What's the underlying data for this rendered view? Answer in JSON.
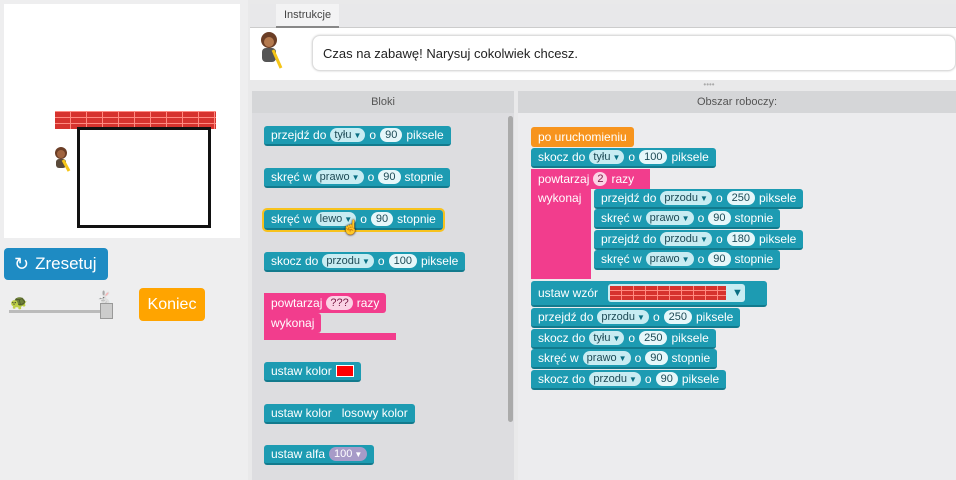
{
  "left": {
    "reset_label": "Zresetuj",
    "finish_label": "Koniec",
    "speed_slow_icon": "turtle-icon",
    "speed_fast_icon": "hare-icon"
  },
  "instructions": {
    "tab_label": "Instrukcje",
    "text": "Czas na zabawę! Narysuj cokolwiek chcesz."
  },
  "headers": {
    "blocks": "Bloki",
    "workspace": "Obszar roboczy:"
  },
  "toolbox": {
    "b1": {
      "text": "przejdź do",
      "dir": "tyłu",
      "o": "o",
      "num": "90",
      "unit": "piksele"
    },
    "b2": {
      "text": "skręć w",
      "dir": "prawo",
      "o": "o",
      "num": "90",
      "unit": "stopnie"
    },
    "b3": {
      "text": "skręć w",
      "dir": "lewo",
      "o": "o",
      "num": "90",
      "unit": "stopnie"
    },
    "b4": {
      "text": "skocz do",
      "dir": "przodu",
      "o": "o",
      "num": "100",
      "unit": "piksele"
    },
    "b5": {
      "text": "powtarzaj",
      "num": "???",
      "unit": "razy",
      "do": "wykonaj"
    },
    "b6": {
      "text": "ustaw kolor",
      "color": "#ff0000"
    },
    "b7": {
      "text": "ustaw kolor",
      "value": "losowy kolor"
    },
    "b8": {
      "text": "ustaw alfa",
      "num": "100"
    }
  },
  "workspace": {
    "w0": {
      "text": "po uruchomieniu"
    },
    "w1": {
      "text": "skocz do",
      "dir": "tyłu",
      "o": "o",
      "num": "100",
      "unit": "piksele"
    },
    "w2": {
      "text": "powtarzaj",
      "num": "2",
      "unit": "razy",
      "do": "wykonaj"
    },
    "w3": {
      "text": "przejdź do",
      "dir": "przodu",
      "o": "o",
      "num": "250",
      "unit": "piksele"
    },
    "w4": {
      "text": "skręć w",
      "dir": "prawo",
      "o": "o",
      "num": "90",
      "unit": "stopnie"
    },
    "w5": {
      "text": "przejdź do",
      "dir": "przodu",
      "o": "o",
      "num": "180",
      "unit": "piksele"
    },
    "w6": {
      "text": "skręć w",
      "dir": "prawo",
      "o": "o",
      "num": "90",
      "unit": "stopnie"
    },
    "w7": {
      "text": "ustaw wzór"
    },
    "w8": {
      "text": "przejdź do",
      "dir": "przodu",
      "o": "o",
      "num": "250",
      "unit": "piksele"
    },
    "w9": {
      "text": "skocz do",
      "dir": "tyłu",
      "o": "o",
      "num": "250",
      "unit": "piksele"
    },
    "w10": {
      "text": "skręć w",
      "dir": "prawo",
      "o": "o",
      "num": "90",
      "unit": "stopnie"
    },
    "w11": {
      "text": "skocz do",
      "dir": "przodu",
      "o": "o",
      "num": "90",
      "unit": "piksele"
    }
  }
}
